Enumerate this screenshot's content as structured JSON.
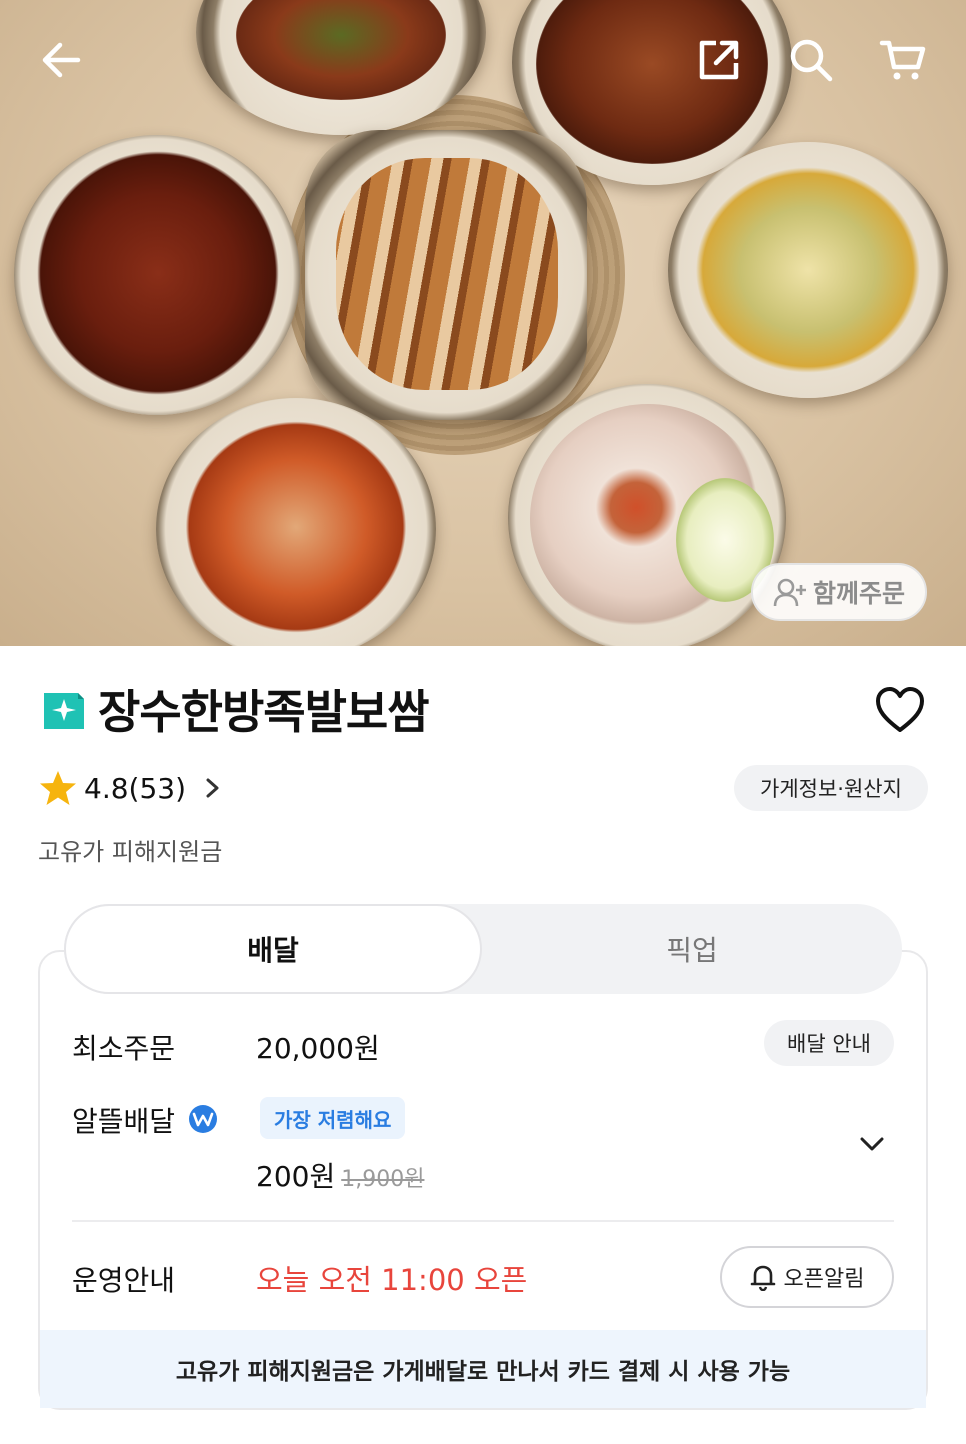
{
  "hero": {
    "together_order_label": "함께주문"
  },
  "store": {
    "name": "장수한방족발보쌈",
    "rating": "4.8(53)",
    "info_button": "가게정보·원산지",
    "subsidy_text": "고유가 피해지원금"
  },
  "tabs": {
    "delivery": "배달",
    "pickup": "픽업"
  },
  "delivery": {
    "min_order_label": "최소주문",
    "min_order_value": "20,000원",
    "delivery_info_button": "배달 안내",
    "saver_label": "알뜰배달",
    "cheapest_badge": "가장 저렴해요",
    "saver_price": "200원",
    "saver_original_price": "1,900원",
    "hours_label": "운영안내",
    "hours_value": "오늘 오전 11:00 오픈",
    "open_alarm_button": "오픈알림",
    "notice": "고유가 피해지원금은 가게배달로 만나서 카드 결제 시 사용 가능"
  },
  "colors": {
    "accent_red": "#e8453c",
    "badge_blue": "#2a7de1",
    "star": "#f6b40e",
    "logo_teal": "#1fc2b4"
  }
}
